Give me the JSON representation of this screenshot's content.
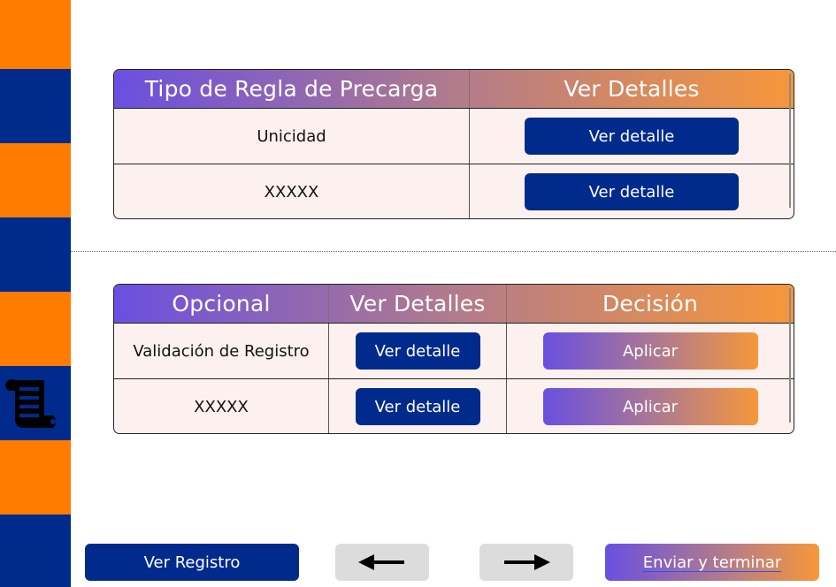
{
  "sidebar": {
    "stripes": [
      "orange",
      "blue",
      "orange",
      "blue",
      "orange",
      "blue",
      "orange",
      "blue"
    ],
    "colors": {
      "orange": "#ff7c00",
      "blue": "#002a8c"
    },
    "icon": "scroll-icon"
  },
  "table1": {
    "headers": [
      "Tipo de Regla de Precarga",
      "Ver Detalles"
    ],
    "rows": [
      {
        "label": "Unicidad",
        "action": "Ver detalle"
      },
      {
        "label": "XXXXX",
        "action": "Ver detalle"
      }
    ]
  },
  "table2": {
    "headers": [
      "Opcional",
      "Ver Detalles",
      "Decisión"
    ],
    "rows": [
      {
        "label": "Validación de Registro",
        "action": "Ver detalle",
        "decision": "Aplicar"
      },
      {
        "label": "XXXXX",
        "action": "Ver detalle",
        "decision": "Aplicar"
      }
    ]
  },
  "footer": {
    "ver_registro": "Ver Registro",
    "back_icon": "arrow-left-icon",
    "forward_icon": "arrow-right-icon",
    "enviar": "Enviar y terminar"
  },
  "colors": {
    "accent_blue": "#002a8c",
    "gradient_start": "#6a4fe0",
    "gradient_end": "#f7973a",
    "row_bg": "#fdf1ef"
  }
}
